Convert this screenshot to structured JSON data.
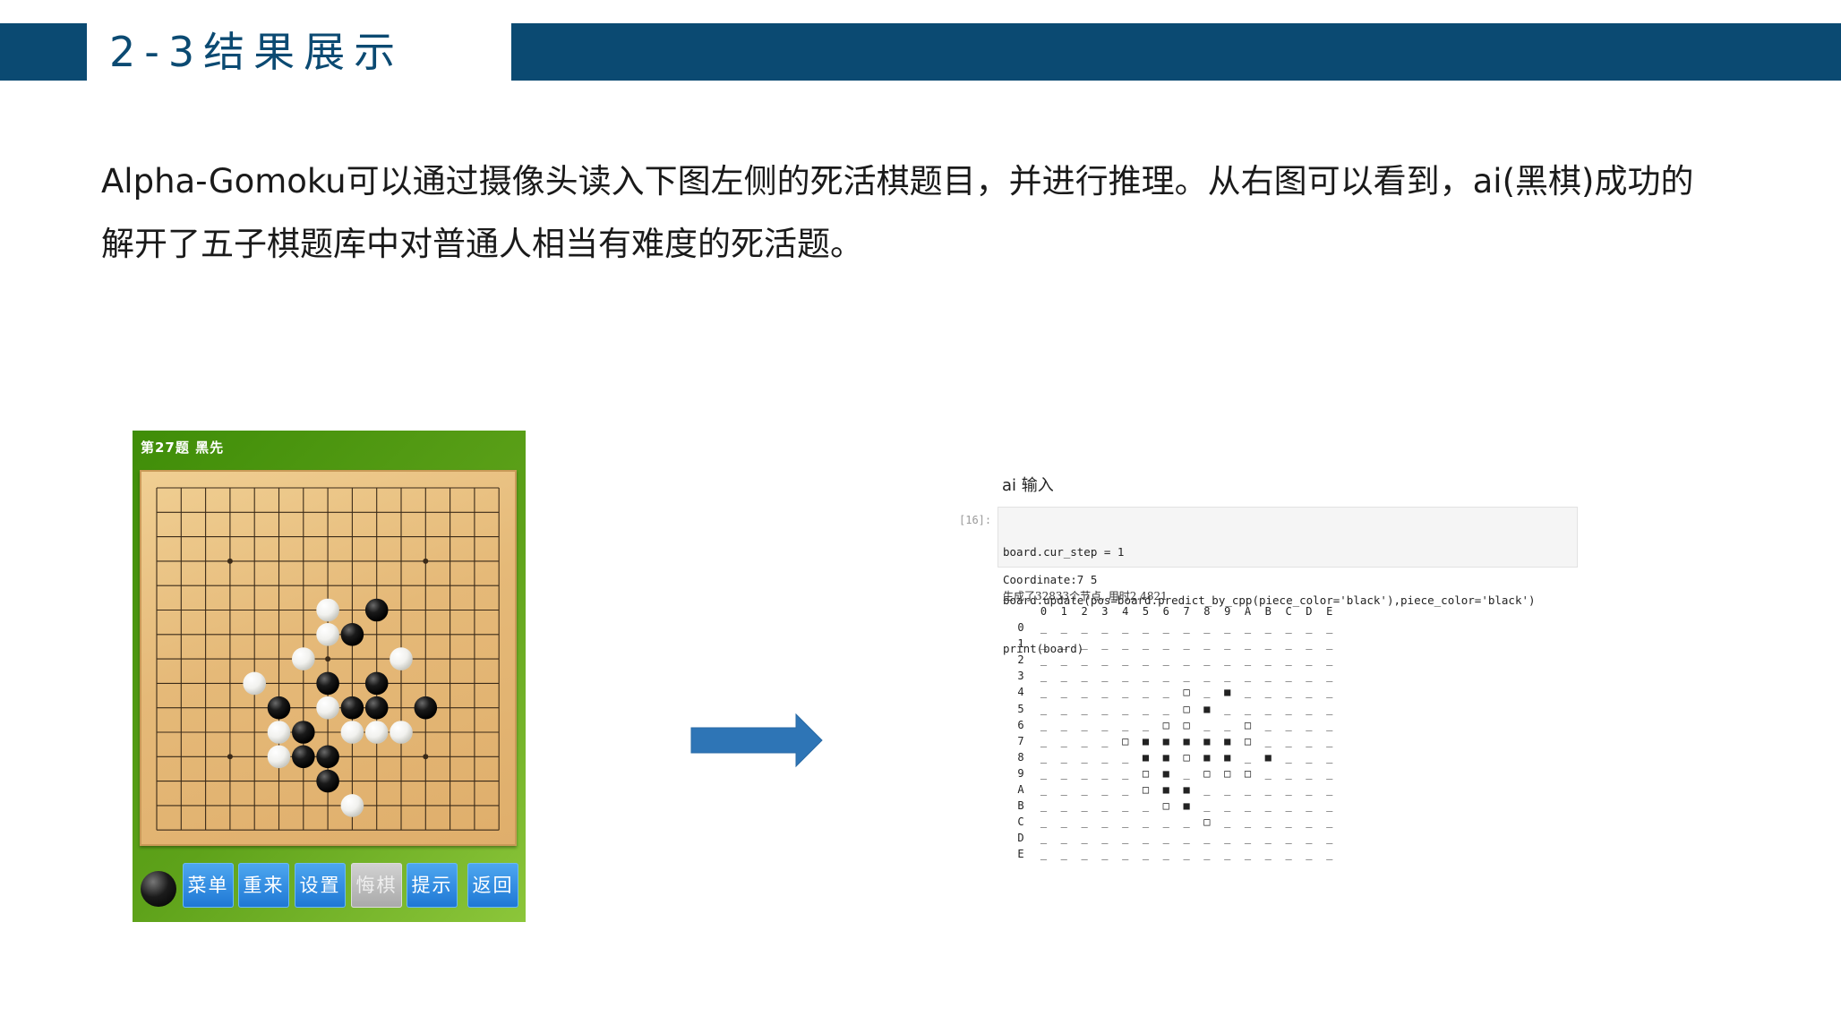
{
  "header": {
    "title": "2-3结果展示"
  },
  "intro": {
    "line1": "Alpha-Gomoku可以通过摄像头读入下图左侧的死活棋题目，并进行推理。从右图可以看到，ai(黑棋)成功的",
    "line2": "解开了五子棋题库中对普通人相当有难度的死活题。"
  },
  "game": {
    "title": "第27题  黑先",
    "buttons": [
      {
        "label": "菜单",
        "enabled": true
      },
      {
        "label": "重来",
        "enabled": true
      },
      {
        "label": "设置",
        "enabled": true
      },
      {
        "label": "悔棋",
        "enabled": false
      },
      {
        "label": "提示",
        "enabled": true
      },
      {
        "label": "返回",
        "enabled": true
      }
    ],
    "turn_color": "black",
    "stones": [
      {
        "col": 7,
        "row": 5,
        "color": "white"
      },
      {
        "col": 9,
        "row": 5,
        "color": "black"
      },
      {
        "col": 7,
        "row": 6,
        "color": "white"
      },
      {
        "col": 8,
        "row": 6,
        "color": "black"
      },
      {
        "col": 6,
        "row": 7,
        "color": "white"
      },
      {
        "col": 10,
        "row": 7,
        "color": "white"
      },
      {
        "col": 4,
        "row": 8,
        "color": "white"
      },
      {
        "col": 7,
        "row": 8,
        "color": "black"
      },
      {
        "col": 9,
        "row": 8,
        "color": "black"
      },
      {
        "col": 5,
        "row": 9,
        "color": "black"
      },
      {
        "col": 7,
        "row": 9,
        "color": "white"
      },
      {
        "col": 8,
        "row": 9,
        "color": "black"
      },
      {
        "col": 9,
        "row": 9,
        "color": "black"
      },
      {
        "col": 11,
        "row": 9,
        "color": "black"
      },
      {
        "col": 5,
        "row": 10,
        "color": "white"
      },
      {
        "col": 6,
        "row": 10,
        "color": "black"
      },
      {
        "col": 8,
        "row": 10,
        "color": "white"
      },
      {
        "col": 9,
        "row": 10,
        "color": "white"
      },
      {
        "col": 10,
        "row": 10,
        "color": "white"
      },
      {
        "col": 5,
        "row": 11,
        "color": "white"
      },
      {
        "col": 6,
        "row": 11,
        "color": "black"
      },
      {
        "col": 7,
        "row": 11,
        "color": "black"
      },
      {
        "col": 7,
        "row": 12,
        "color": "black"
      },
      {
        "col": 8,
        "row": 13,
        "color": "white"
      }
    ]
  },
  "notebook": {
    "heading": "ai 输入",
    "prompt": "[16]:",
    "code": [
      "board.cur_step = 1",
      "board.update(pos=board.predict_by_cpp(piece_color='black'),piece_color='black')",
      "print(board)"
    ],
    "output": {
      "coordinate": "Coordinate:7 5",
      "stats": "生成了32833个节点, 用时2.4821",
      "columns": [
        "0",
        "1",
        "2",
        "3",
        "4",
        "5",
        "6",
        "7",
        "8",
        "9",
        "A",
        "B",
        "C",
        "D",
        "E"
      ],
      "rows": [
        {
          "label": "0",
          "cells": "_ _ _ _ _ _ _ _ _ _ _ _ _ _ _"
        },
        {
          "label": "1",
          "cells": "_ _ _ _ _ _ _ _ _ _ _ _ _ _ _"
        },
        {
          "label": "2",
          "cells": "_ _ _ _ _ _ _ _ _ _ _ _ _ _ _"
        },
        {
          "label": "3",
          "cells": "_ _ _ _ _ _ _ _ _ _ _ _ _ _ _"
        },
        {
          "label": "4",
          "cells": "_ _ _ _ _ _ _ □ _ ■ _ _ _ _ _"
        },
        {
          "label": "5",
          "cells": "_ _ _ _ _ _ _ □ ■ _ _ _ _ _ _"
        },
        {
          "label": "6",
          "cells": "_ _ _ _ _ _ □ □ _ _ □ _ _ _ _"
        },
        {
          "label": "7",
          "cells": "_ _ _ _ □ ■ ■ ■ ■ ■ □ _ _ _ _"
        },
        {
          "label": "8",
          "cells": "_ _ _ _ _ ■ ■ □ ■ ■ _ ■ _ _ _"
        },
        {
          "label": "9",
          "cells": "_ _ _ _ _ □ ■ _ □ □ □ _ _ _ _"
        },
        {
          "label": "A",
          "cells": "_ _ _ _ _ □ ■ ■ _ _ _ _ _ _ _"
        },
        {
          "label": "B",
          "cells": "_ _ _ _ _ _ □ ■ _ _ _ _ _ _ _"
        },
        {
          "label": "C",
          "cells": "_ _ _ _ _ _ _ _ □ _ _ _ _ _ _"
        },
        {
          "label": "D",
          "cells": "_ _ _ _ _ _ _ _ _ _ _ _ _ _ _"
        },
        {
          "label": "E",
          "cells": "_ _ _ _ _ _ _ _ _ _ _ _ _ _ _"
        }
      ]
    }
  },
  "colors": {
    "header_blue": "#0b4a72",
    "arrow_blue": "#2e75b6",
    "board_wood": "#e5b978",
    "game_green": "#4b9410",
    "button_blue": "#1e77d4"
  }
}
